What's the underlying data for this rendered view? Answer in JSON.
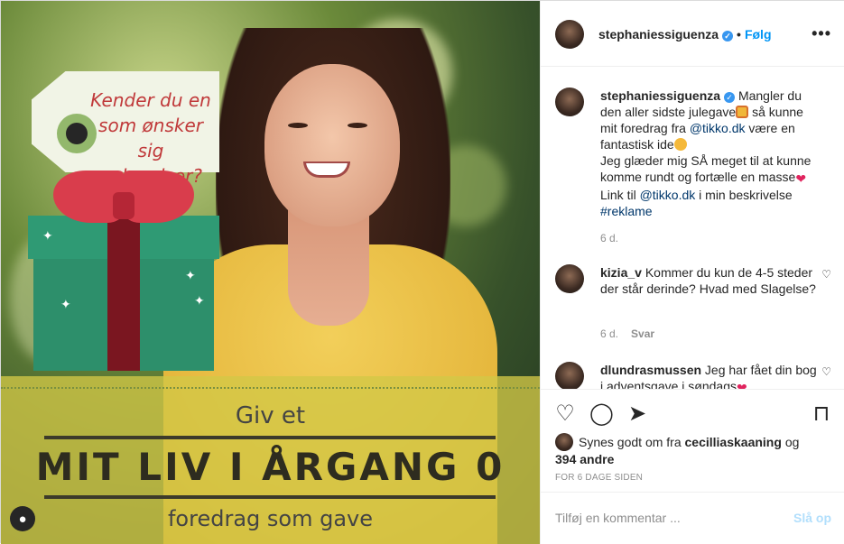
{
  "media": {
    "tag_text": "Kender du en som ønsker sig oplevelser?",
    "banner_top": "Giv et",
    "banner_title": "MIT LIV I ÅRGANG 0",
    "banner_bottom": "foredrag som gave",
    "user_tags_icon": "person-icon"
  },
  "header": {
    "username": "stephaniessiguenza",
    "separator": "•",
    "follow_label": "Følg",
    "more_icon": "•••"
  },
  "caption": {
    "username": "stephaniessiguenza",
    "text_1": "Mangler du den aller sidste julegave",
    "text_2": "så kunne mit foredrag fra",
    "mention_1": "@tikko.dk",
    "text_3": "være en fantastisk ide",
    "text_4": "Jeg glæder mig SÅ meget til at kunne komme rundt og fortælle en masse",
    "text_5": "Link til",
    "mention_2": "@tikko.dk",
    "text_6": "i min beskrivelse",
    "hashtag": "#reklame",
    "time": "6 d."
  },
  "comments": [
    {
      "username": "kizia_v",
      "text": "Kommer du kun de 4-5 steder der står derinde? Hvad med Slagelse?",
      "time": "6 d.",
      "reply_label": "Svar"
    },
    {
      "username": "dlundrasmussen",
      "text": "Jeg har fået din bog i adventsgave i søndags"
    }
  ],
  "actions": {
    "like_icon": "heart-outline-icon",
    "comment_icon": "comment-icon",
    "share_icon": "paper-plane-icon",
    "save_icon": "bookmark-icon"
  },
  "likes": {
    "prefix": "Synes godt om fra",
    "user": "cecilliaskaaning",
    "joiner": "og",
    "others": "394 andre"
  },
  "timestamp": "FOR 6 DAGE SIDEN",
  "composer": {
    "placeholder": "Tilføj en kommentar ...",
    "post_label": "Slå op"
  },
  "colors": {
    "link_blue": "#0095f6",
    "mention_blue": "#00376b",
    "muted": "#8e8e8e",
    "heart_red": "#e0245e"
  }
}
